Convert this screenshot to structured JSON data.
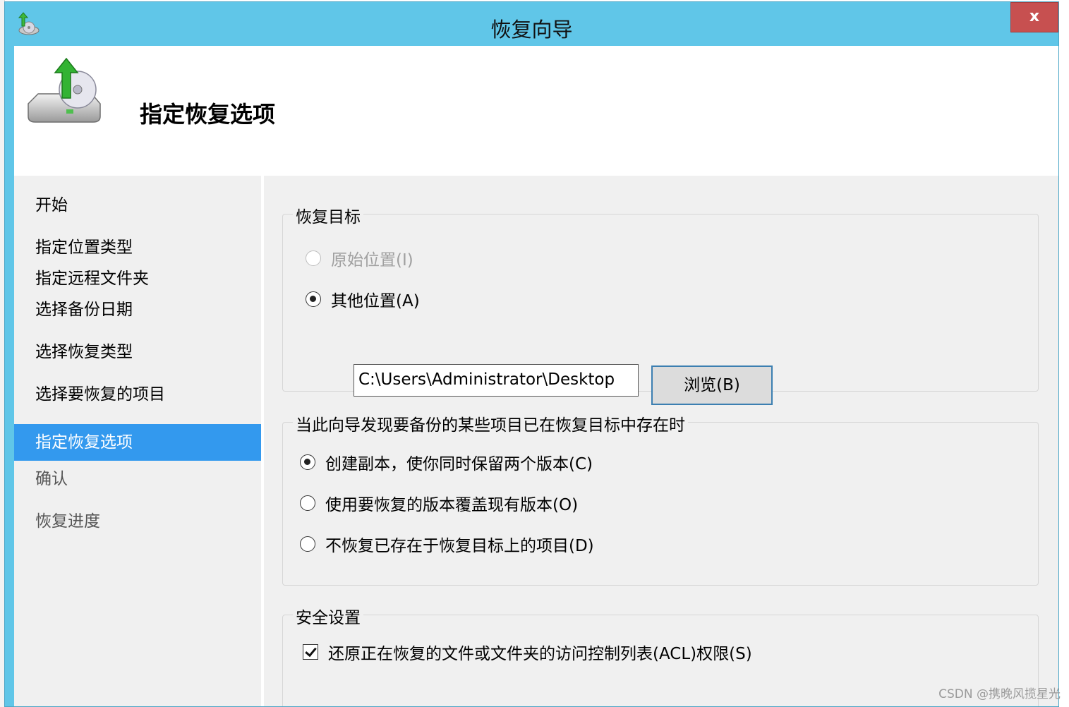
{
  "window": {
    "title": "恢复向导",
    "close_label": "x"
  },
  "header": {
    "title": "指定恢复选项"
  },
  "nav": {
    "items": [
      {
        "label": "开始",
        "state": "normal"
      },
      {
        "label": "指定位置类型",
        "state": "normal"
      },
      {
        "label": "指定远程文件夹",
        "state": "normal"
      },
      {
        "label": "选择备份日期",
        "state": "normal"
      },
      {
        "label": "选择恢复类型",
        "state": "normal"
      },
      {
        "label": "选择要恢复的项目",
        "state": "normal"
      },
      {
        "label": "指定恢复选项",
        "state": "active"
      },
      {
        "label": "确认",
        "state": "disabled"
      },
      {
        "label": "恢复进度",
        "state": "disabled"
      }
    ]
  },
  "restore_target": {
    "label": "恢复目标",
    "original": {
      "label": "原始位置(I)",
      "checked": false,
      "disabled": true
    },
    "other": {
      "label": "其他位置(A)",
      "checked": true
    },
    "path_value": "C:\\Users\\Administrator\\Desktop",
    "browse_label": "浏览(B)"
  },
  "conflict": {
    "label": "当此向导发现要备份的某些项目已在恢复目标中存在时",
    "options": [
      {
        "label": "创建副本，使你同时保留两个版本(C)",
        "checked": true
      },
      {
        "label": "使用要恢复的版本覆盖现有版本(O)",
        "checked": false
      },
      {
        "label": "不恢复已存在于恢复目标上的项目(D)",
        "checked": false
      }
    ]
  },
  "security": {
    "label": "安全设置",
    "acl_label": "还原正在恢复的文件或文件夹的访问控制列表(ACL)权限(S)",
    "acl_checked": true
  },
  "watermark": "CSDN @携晚风揽星光",
  "colors": {
    "titlebar": "#60c6e8",
    "nav_active": "#3399ee",
    "close": "#c75050",
    "panel": "#f0f0f0"
  },
  "icons": {
    "app": "backup-restore-icon",
    "header": "disk-restore-icon",
    "close": "close-icon"
  }
}
